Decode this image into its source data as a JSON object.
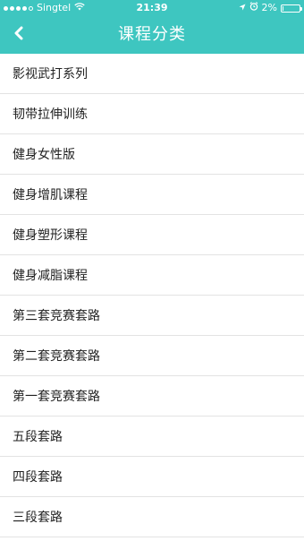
{
  "status_bar": {
    "carrier": "Singtel",
    "time": "21:39",
    "battery": "2%",
    "battery_level": 0.02
  },
  "nav": {
    "title": "课程分类",
    "back_icon": "chevron-left-icon"
  },
  "colors": {
    "accent": "#3ec6c0",
    "divider": "#e3e3e3",
    "text": "#222222"
  },
  "categories": [
    {
      "label": "影视武打系列"
    },
    {
      "label": "韧带拉伸训练"
    },
    {
      "label": "健身女性版"
    },
    {
      "label": "健身增肌课程"
    },
    {
      "label": "健身塑形课程"
    },
    {
      "label": "健身减脂课程"
    },
    {
      "label": "第三套竞赛套路"
    },
    {
      "label": "第二套竞赛套路"
    },
    {
      "label": "第一套竞赛套路"
    },
    {
      "label": "五段套路"
    },
    {
      "label": "四段套路"
    },
    {
      "label": "三段套路"
    }
  ]
}
